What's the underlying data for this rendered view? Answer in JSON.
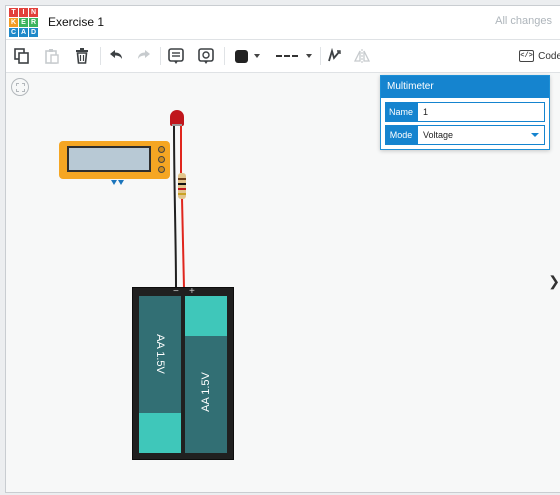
{
  "app": {
    "logo_letters": [
      "T",
      "I",
      "N",
      "K",
      "E",
      "R",
      "C",
      "A",
      "D"
    ],
    "title": "Exercise 1",
    "save_status": "All changes"
  },
  "toolbar": {
    "tools": [
      "copy-icon",
      "paste-icon",
      "delete-icon",
      "undo-icon",
      "redo-icon",
      "note-icon",
      "notes-toggle-icon",
      "color-swatch",
      "line-style",
      "rotate-icon",
      "flip-icon"
    ],
    "code_label": "Code"
  },
  "inspector": {
    "title": "Multimeter",
    "name_label": "Name",
    "name_value": "1",
    "mode_label": "Mode",
    "mode_value": "Voltage"
  },
  "battery": {
    "cell_left_label": "AA 1.5V",
    "cell_right_label": "AA 1.5V",
    "minus_symbol": "−",
    "plus_symbol": "+"
  },
  "colors": {
    "accent": "#1584cf",
    "meter": "#f5a623",
    "battery_cap": "#3fc7ba",
    "battery_body": "#326f74",
    "led": "#c0161c",
    "wire_red": "#e0261e",
    "wire_black": "#202020"
  }
}
